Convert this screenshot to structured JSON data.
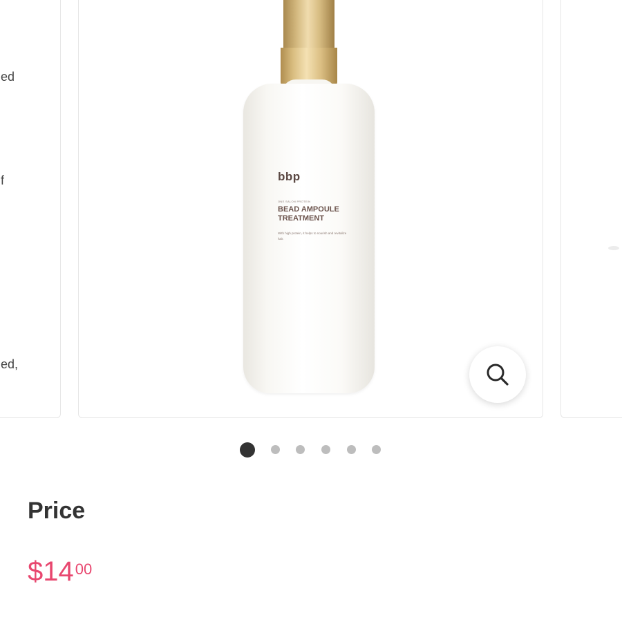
{
  "carousel": {
    "prev_card_fragments": [
      "ed",
      "f",
      "ed,"
    ],
    "product_image": {
      "brand": "bbp",
      "subtitle": "ONE SALON PROTEIN",
      "name_line1": "BEAD AMPOULE",
      "name_line2": "TREATMENT",
      "description": "With high protein, it helps to nourish and revitalize hair."
    },
    "zoom_icon": "search-icon",
    "page_count": 6,
    "active_page": 1
  },
  "price": {
    "label": "Price",
    "amount_main": "$14",
    "amount_cents": "00"
  },
  "colors": {
    "price_accent": "#e8476f",
    "dot_active": "#333333",
    "dot_inactive": "#bdbdbd"
  }
}
